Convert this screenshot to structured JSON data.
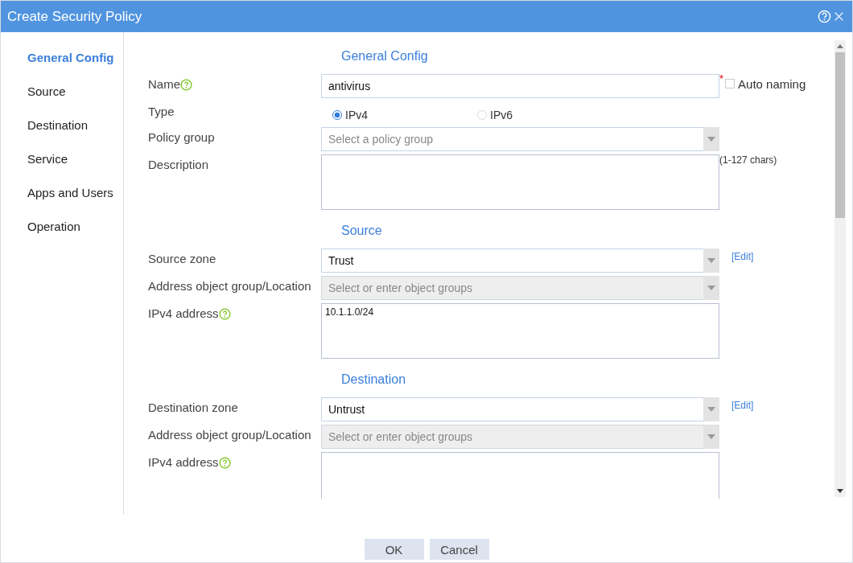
{
  "window": {
    "title": "Create Security Policy"
  },
  "sidebar": {
    "items": [
      {
        "label": "General Config",
        "selected": true
      },
      {
        "label": "Source",
        "selected": false
      },
      {
        "label": "Destination",
        "selected": false
      },
      {
        "label": "Service",
        "selected": false
      },
      {
        "label": "Apps and Users",
        "selected": false
      },
      {
        "label": "Operation",
        "selected": false
      }
    ]
  },
  "sections": [
    {
      "title": "General Config",
      "fields": [
        {
          "kind": "text",
          "label": "Name",
          "help": true,
          "value": "antivirus",
          "required_mark": "*",
          "checkbox": {
            "label": "Auto naming",
            "checked": false
          }
        },
        {
          "kind": "radio",
          "label": "Type",
          "options": [
            {
              "label": "IPv4",
              "selected": true
            },
            {
              "label": "IPv6",
              "selected": false
            }
          ]
        },
        {
          "kind": "select",
          "label": "Policy group",
          "placeholder": "Select a policy group",
          "disabled": false
        },
        {
          "kind": "textarea",
          "label": "Description",
          "hint": "(1-127 chars)"
        }
      ]
    },
    {
      "title": "Source",
      "fields": [
        {
          "kind": "select",
          "label": "Source zone",
          "value": "Trust",
          "disabled": false,
          "link": "[Edit]"
        },
        {
          "kind": "select",
          "label": "Address object group/Location",
          "placeholder": "Select or enter object groups",
          "disabled": true
        },
        {
          "kind": "textarea",
          "label": "IPv4 address",
          "help": true,
          "value": "10.1.1.0/24"
        }
      ]
    },
    {
      "title": "Destination",
      "fields": [
        {
          "kind": "select",
          "label": "Destination zone",
          "value": "Untrust",
          "disabled": false,
          "link": "[Edit]"
        },
        {
          "kind": "select",
          "label": "Address object group/Location",
          "placeholder": "Select or enter object groups",
          "disabled": true
        },
        {
          "kind": "textarea",
          "label": "IPv4 address",
          "help": true
        }
      ]
    }
  ],
  "buttons": [
    "OK",
    "Cancel"
  ]
}
